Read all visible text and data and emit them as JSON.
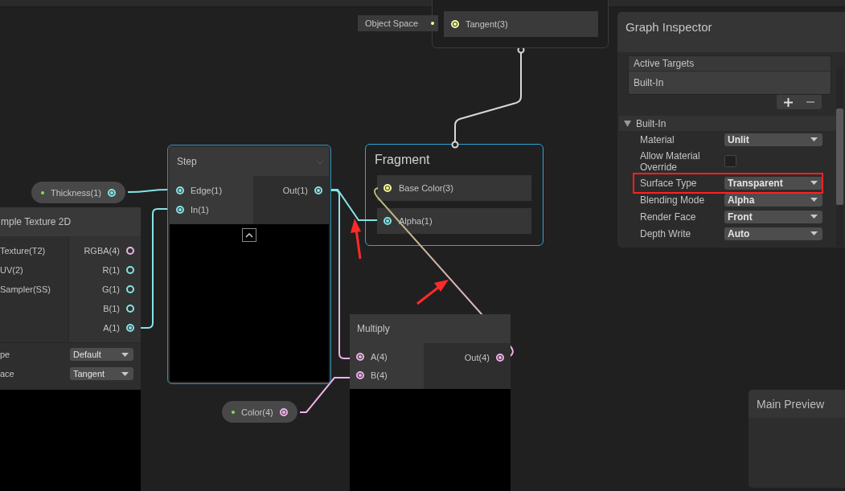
{
  "properties": [
    {
      "label": "Thickness(1)",
      "color": "#84e4e7",
      "connected": true
    },
    {
      "label": "Color(4)",
      "color": "#f1b1ea",
      "connected": true
    }
  ],
  "object_space": {
    "label": "Object Space",
    "port": {
      "label": "Tangent(3)",
      "color": "#f6ff9a",
      "connected": true
    }
  },
  "sample_texture": {
    "title": "mple Texture 2D",
    "inputs": [
      "Texture(T2)",
      "UV(2)",
      "Sampler(SS)"
    ],
    "outputs": [
      {
        "label": "RGBA(4)",
        "color": "#f1b1ea",
        "connected": false
      },
      {
        "label": "R(1)",
        "color": "#84e4e7",
        "connected": false
      },
      {
        "label": "G(1)",
        "color": "#84e4e7",
        "connected": false
      },
      {
        "label": "B(1)",
        "color": "#84e4e7",
        "connected": false
      },
      {
        "label": "A(1)",
        "color": "#84e4e7",
        "connected": true
      }
    ],
    "fields": [
      {
        "label": "pe",
        "value": "Default"
      },
      {
        "label": "ace",
        "value": "Tangent"
      }
    ]
  },
  "step": {
    "title": "Step",
    "selected": true,
    "inputs": [
      {
        "label": "Edge(1)",
        "color": "#84e4e7",
        "connected": true
      },
      {
        "label": "In(1)",
        "color": "#84e4e7",
        "connected": true
      }
    ],
    "outputs": [
      {
        "label": "Out(1)",
        "color": "#84e4e7",
        "connected": true
      }
    ]
  },
  "fragment": {
    "title": "Fragment",
    "selected": true,
    "ports": [
      {
        "label": "Base Color(3)",
        "color": "#f6ff9a",
        "connected": true
      },
      {
        "label": "Alpha(1)",
        "color": "#84e4e7",
        "connected": true
      }
    ]
  },
  "multiply": {
    "title": "Multiply",
    "selected": false,
    "inputs": [
      {
        "label": "A(4)",
        "color": "#f1b1ea",
        "connected": true
      },
      {
        "label": "B(4)",
        "color": "#f1b1ea",
        "connected": true
      }
    ],
    "outputs": [
      {
        "label": "Out(4)",
        "color": "#f1b1ea",
        "connected": true
      }
    ]
  },
  "inspector": {
    "title": "Graph Inspector",
    "active_targets": {
      "title": "Active Targets",
      "items": [
        "Built-In"
      ]
    },
    "section": {
      "title": "Built-In",
      "expanded": true,
      "rows": [
        {
          "kind": "dropdown",
          "label": "Material",
          "value": "Unlit"
        },
        {
          "kind": "checkbox",
          "label": "Allow Material Override",
          "checked": false
        },
        {
          "kind": "dropdown",
          "label": "Surface Type",
          "value": "Transparent"
        },
        {
          "kind": "dropdown",
          "label": "Blending Mode",
          "value": "Alpha"
        },
        {
          "kind": "dropdown",
          "label": "Render Face",
          "value": "Front"
        },
        {
          "kind": "dropdown",
          "label": "Depth Write",
          "value": "Auto"
        }
      ]
    }
  },
  "main_preview": {
    "title": "Main Preview"
  }
}
